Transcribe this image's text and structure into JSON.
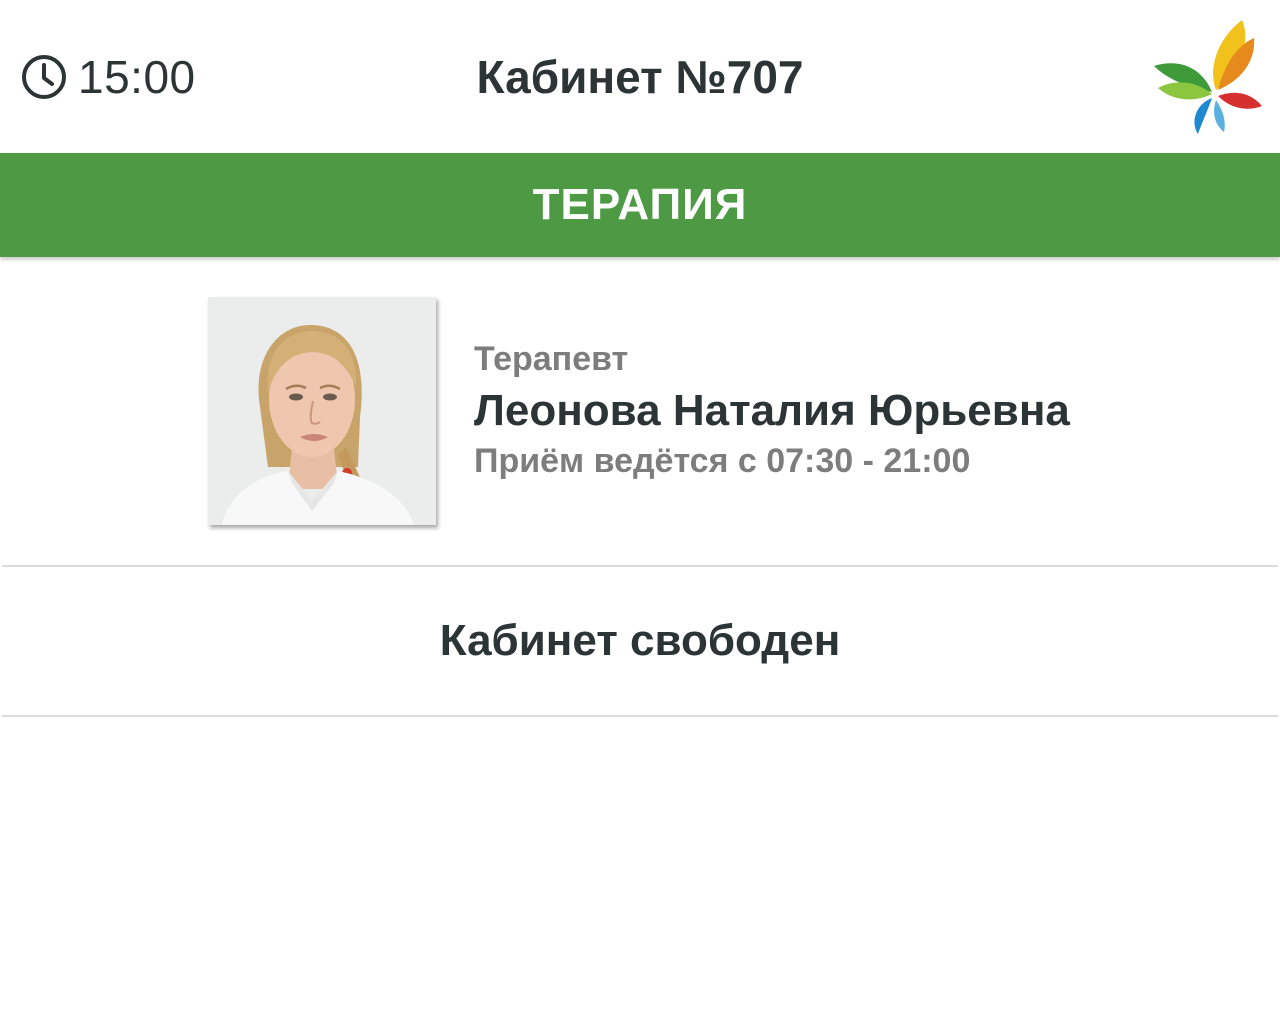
{
  "header": {
    "time": "15:00",
    "clock_icon": "clock-icon",
    "room_title": "Кабинет №707",
    "logo_icon": "butterfly-logo"
  },
  "department": {
    "name": "ТЕРАПИЯ",
    "color": "#4e9a44"
  },
  "doctor": {
    "specialty": "Терапевт",
    "name": "Леонова Наталия Юрьевна",
    "hours": "Приём ведётся с 07:30 - 21:00"
  },
  "status": {
    "text": "Кабинет свободен"
  }
}
